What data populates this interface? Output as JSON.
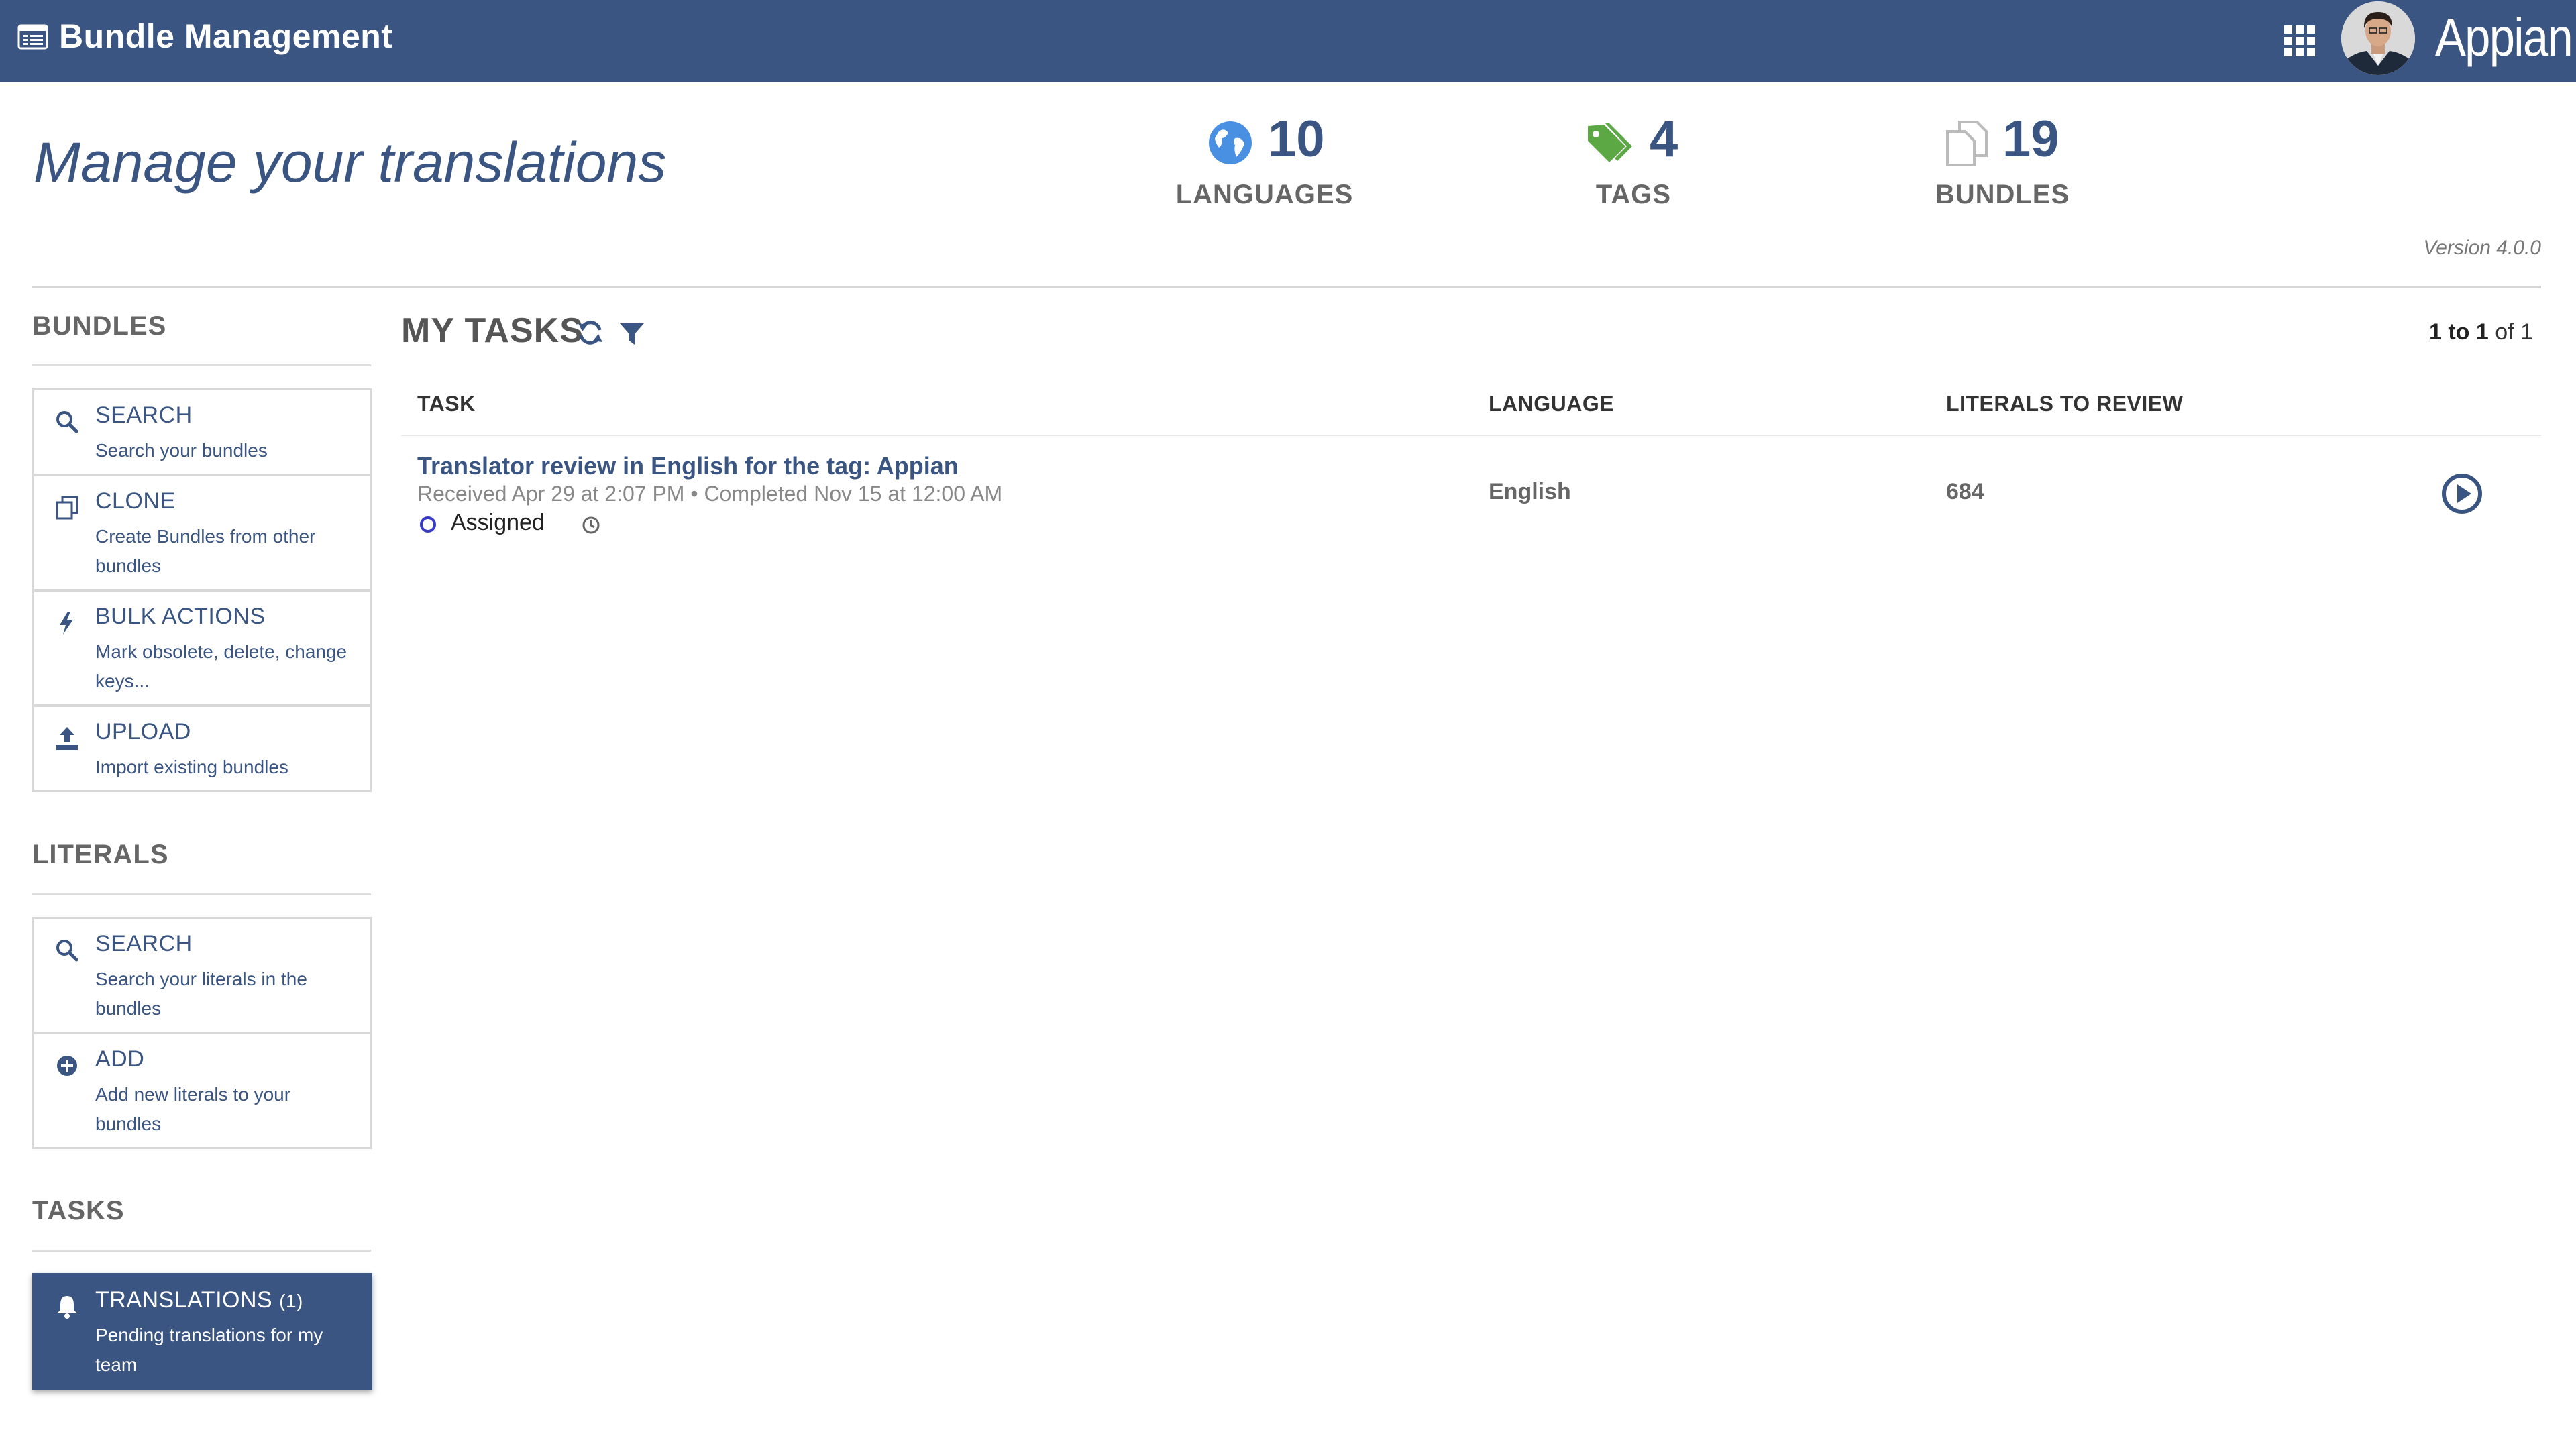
{
  "header": {
    "app_title": "Bundle Management",
    "brand": "Appian",
    "color": "#3b5582"
  },
  "page": {
    "title": "Manage your translations",
    "version": "Version 4.0.0"
  },
  "stats": [
    {
      "icon": "globe-icon",
      "value": "10",
      "label": "LANGUAGES",
      "color": "#4a90e2"
    },
    {
      "icon": "tags-icon",
      "value": "4",
      "label": "TAGS",
      "color": "#5ba845"
    },
    {
      "icon": "documents-icon",
      "value": "19",
      "label": "BUNDLES",
      "color": "#bbbbbb"
    }
  ],
  "sidebar": {
    "bundles": {
      "heading": "BUNDLES",
      "items": [
        {
          "icon": "search-icon",
          "title": "SEARCH",
          "desc": "Search your bundles"
        },
        {
          "icon": "clone-icon",
          "title": "CLONE",
          "desc": "Create Bundles from other bundles"
        },
        {
          "icon": "bolt-icon",
          "title": "BULK ACTIONS",
          "desc": "Mark obsolete, delete, change keys..."
        },
        {
          "icon": "upload-icon",
          "title": "UPLOAD",
          "desc": "Import existing bundles"
        }
      ]
    },
    "literals": {
      "heading": "LITERALS",
      "items": [
        {
          "icon": "search-icon",
          "title": "SEARCH",
          "desc": "Search your literals in the bundles"
        },
        {
          "icon": "add-circle-icon",
          "title": "ADD",
          "desc": "Add new literals to your bundles"
        }
      ]
    },
    "tasks": {
      "heading": "TASKS",
      "items": [
        {
          "icon": "bell-icon",
          "title": "TRANSLATIONS",
          "count": "(1)",
          "desc": "Pending translations for my team"
        }
      ]
    }
  },
  "main": {
    "title": "MY TASKS",
    "paging": {
      "from": "1",
      "to_word": "to",
      "to": "1",
      "of_text": "of 1"
    },
    "columns": [
      "TASK",
      "LANGUAGE",
      "LITERALS TO REVIEW"
    ],
    "rows": [
      {
        "task": "Translator review in English for the tag: Appian",
        "meta": "Received Apr 29 at 2:07 PM • Completed Nov 15 at 12:00 AM",
        "status": "Assigned",
        "language": "English",
        "literals": "684"
      }
    ]
  }
}
